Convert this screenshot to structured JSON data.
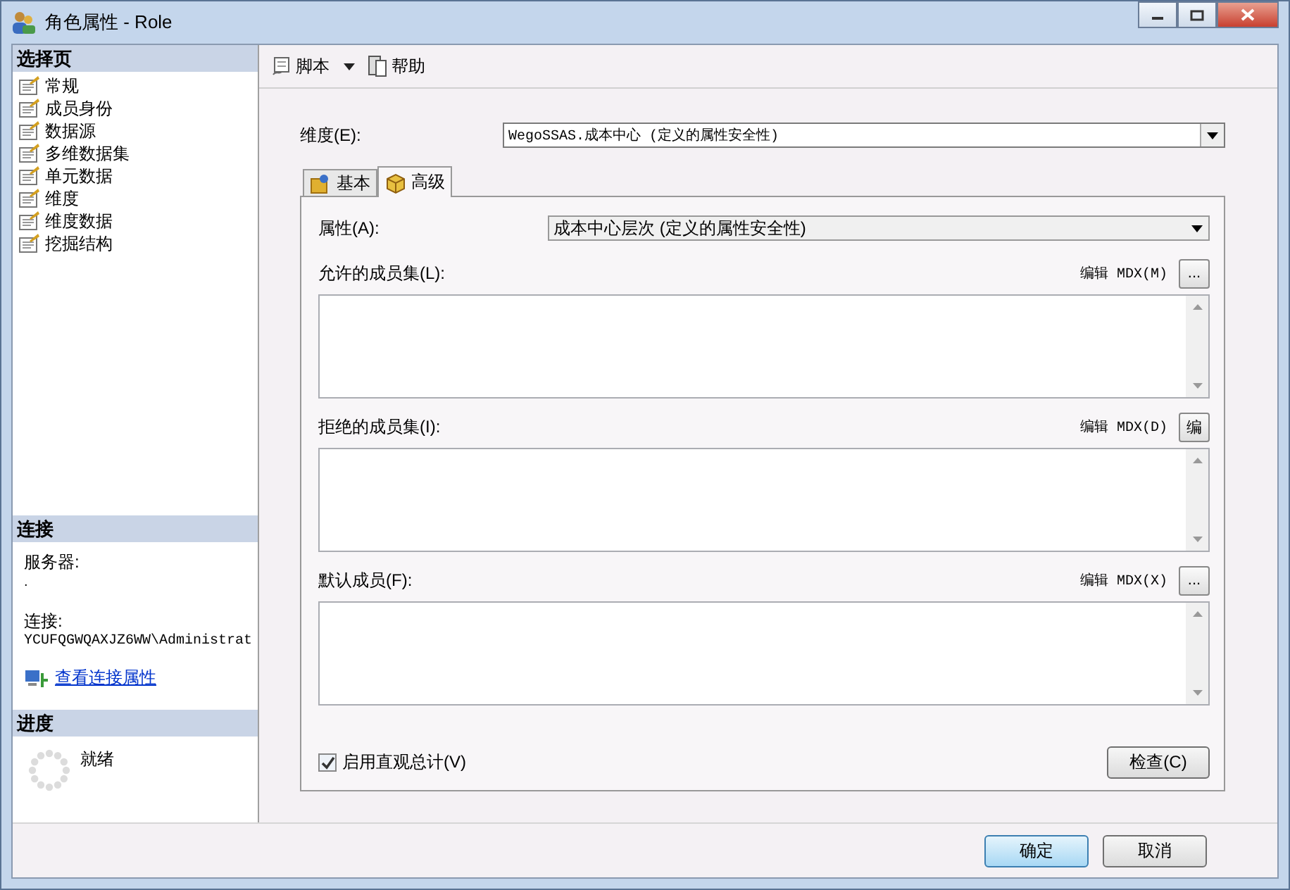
{
  "window": {
    "title": "角色属性 - Role"
  },
  "sidebar": {
    "header": "选择页",
    "items": [
      {
        "label": "常规"
      },
      {
        "label": "成员身份"
      },
      {
        "label": "数据源"
      },
      {
        "label": "多维数据集"
      },
      {
        "label": "单元数据"
      },
      {
        "label": "维度"
      },
      {
        "label": "维度数据"
      },
      {
        "label": "挖掘结构"
      }
    ]
  },
  "connection": {
    "header": "连接",
    "server_label": "服务器:",
    "server_value": ".",
    "connection_label": "连接:",
    "connection_value": "YCUFQGWQAXJZ6WW\\Administrat",
    "link": "查看连接属性"
  },
  "progress": {
    "header": "进度",
    "status": "就绪"
  },
  "toolbar": [
    {
      "label": "脚本",
      "kind": "dropdown"
    },
    {
      "label": "帮助",
      "kind": "button"
    }
  ],
  "dimension": {
    "label": "维度(E):",
    "value": "WegoSSAS.成本中心 (定义的属性安全性)"
  },
  "tabs": [
    {
      "label": "基本",
      "selected": false
    },
    {
      "label": "高级",
      "selected": true
    }
  ],
  "attribute": {
    "label": "属性(A):",
    "value": "成本中心层次 (定义的属性安全性)"
  },
  "member_sets": [
    {
      "label": "允许的成员集(L):",
      "edit_label": "编辑 MDX(M)",
      "button": "..."
    },
    {
      "label": "拒绝的成员集(I):",
      "edit_label": "编辑 MDX(D)",
      "button": "编"
    },
    {
      "label": "默认成员(F):",
      "edit_label": "编辑 MDX(X)",
      "button": "..."
    }
  ],
  "visual_totals": {
    "label": "启用直观总计(V)",
    "checked": true
  },
  "check_button": "检查(C)",
  "buttons": [
    {
      "label": "确定",
      "default": true
    },
    {
      "label": "取消",
      "default": false
    }
  ]
}
